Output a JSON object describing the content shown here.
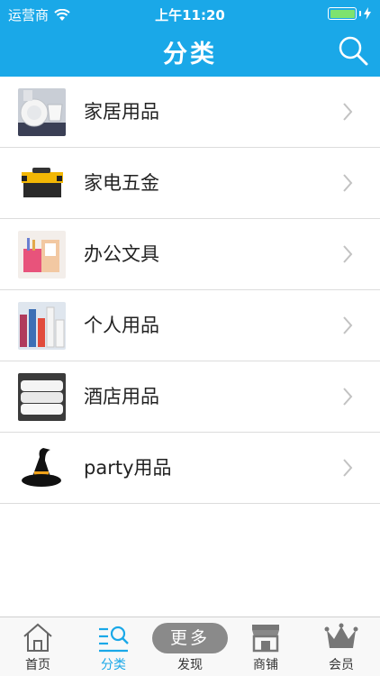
{
  "status_bar": {
    "carrier": "运营商",
    "time": "上午11:20"
  },
  "nav": {
    "title": "分类"
  },
  "categories": [
    {
      "label": "家居用品",
      "icon": "dishes-icon"
    },
    {
      "label": "家电五金",
      "icon": "toolbox-icon"
    },
    {
      "label": "办公文具",
      "icon": "desk-organizer-icon"
    },
    {
      "label": "个人用品",
      "icon": "toiletries-icon"
    },
    {
      "label": "酒店用品",
      "icon": "towels-icon"
    },
    {
      "label": "party用品",
      "icon": "witch-hat-icon"
    }
  ],
  "tabbar": {
    "home": "首页",
    "category": "分类",
    "more_button": "更多",
    "discover": "发现",
    "shop": "商铺",
    "member": "会员"
  },
  "colors": {
    "accent": "#1aa8e8",
    "battery": "#7ee36f"
  }
}
